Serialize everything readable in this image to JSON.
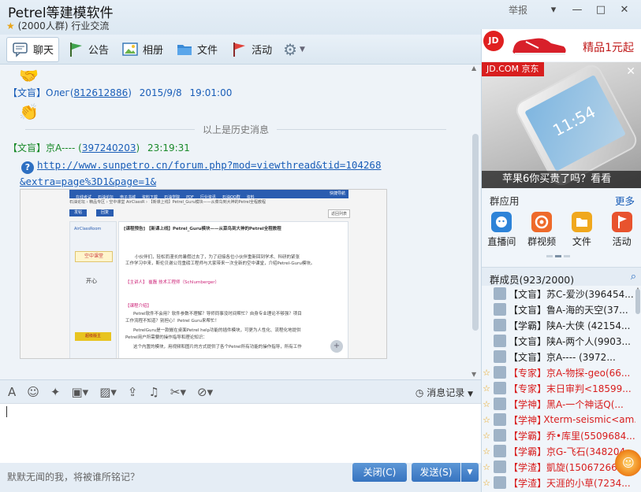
{
  "window": {
    "title": "Petrel等建模软件",
    "member_count": "(2000人群)",
    "category": "行业交流",
    "report_label": "举报",
    "controls": [
      "▾",
      "—",
      "□",
      "✕"
    ]
  },
  "toolbar": {
    "tabs": [
      {
        "label": "聊天",
        "icon": "chat-icon"
      },
      {
        "label": "公告",
        "icon": "announcement-flag-icon"
      },
      {
        "label": "相册",
        "icon": "album-icon"
      },
      {
        "label": "文件",
        "icon": "folder-icon"
      },
      {
        "label": "活动",
        "icon": "activity-flag-icon"
      }
    ],
    "settings_icon": "gear-icon"
  },
  "chat": {
    "msg1": {
      "role": "【文盲】",
      "sender": "Олег(",
      "qq": "812612886",
      "close": ")",
      "date": "2015/9/8",
      "time": "19:01:00"
    },
    "history_separator": "以上是历史消息",
    "msg2": {
      "role": "【文盲】",
      "sender": "京A----",
      "qq": "397240203",
      "time": "23:19:31",
      "link_line1": "http://www.sunpetro.cn/forum.php?mod=viewthread&tid=104268",
      "link_line2": "&extra=page%3D1&page=1&"
    }
  },
  "forum_shot": {
    "nav": [
      "在线考试",
      "石油论坛",
      "电子书城",
      "资料下载",
      "石油学院",
      "PDF",
      "行业资讯",
      "石油QQ群",
      "资料",
      "快捷导航"
    ],
    "breadcrumb": "石油论坛 › 精品专区 › 空中课堂 AirClassR › 【新课上线】Petrel_Guru模块——从菜鸟到大神的Petrel全程教程",
    "post_button": "发帖",
    "reply_button": "回复",
    "return_label": "返回列表",
    "board": "空中课堂",
    "post_title": "[课程预告] 【新课上线】Petrel_Guru模块——从菜鸟到大神的Petrel全程教程",
    "intro": "小伙伴们，轻松而漫长的暑假过去了，为了迎接各位小伙伴重新回到学术、科研的紧张",
    "intro2": "工作学习中来，斯伦贝谢公司重磅工程师与大家带来一次全新的空中课堂，介绍Petrel-Guru模块。",
    "speaker": "【主讲人】 崔磊  技术工程师（Schlumberger）",
    "course": "【课程介绍】",
    "line1": "Petrel软件不会用？软件参数不理解？导师同事没时间帮忙？自身专业理论不够强？项目",
    "line2": "工作流程不知道？别担心！Petrel Guru来帮忙！",
    "line3": "PetrelGuru是一款嵌在桌面Petrel help功能的插件模块，可更为人性化、流程化地提供",
    "line4": "Petrel用户所需要的操作指导和理论知识：",
    "line5": "这个内置的模块，用视频和图片的方式提供了各个Petrel所有功能的操作指导，所有工作",
    "rank_badge": "超级版主",
    "mood": "开心"
  },
  "input_bar": {
    "icons": [
      "font-icon",
      "emoji-icon",
      "magic-icon",
      "gift-icon",
      "image-icon",
      "upload-icon",
      "music-icon",
      "scissors-icon",
      "shake-icon"
    ],
    "history_label": "消息记录",
    "signature": "默默无闻的我，将被谁所铭记？",
    "close_button": "关闭(C)",
    "send_button": "发送(S)"
  },
  "ads": {
    "ad1_brand": "JD",
    "ad1_text": "精品1元起",
    "ad2_tag": "JD.COM 京东",
    "ad2_caption": "苹果6你买贵了吗？看看",
    "ad2_screen_time": "11:54"
  },
  "apps": {
    "header": "群应用",
    "more": "更多",
    "items": [
      {
        "label": "直播间",
        "icon": "live-room-icon",
        "color": "#2d83d8"
      },
      {
        "label": "群视频",
        "icon": "group-video-icon",
        "color": "#ee6a2a"
      },
      {
        "label": "文件",
        "icon": "file-icon",
        "color": "#f0a81e"
      },
      {
        "label": "活动",
        "icon": "activity-icon",
        "color": "#e8532e"
      }
    ]
  },
  "members": {
    "header": "群成员(923/2000)",
    "rows": [
      {
        "role": "【文盲】",
        "name": "苏C-爱沙(396454...",
        "color": "#222222"
      },
      {
        "role": "【文盲】",
        "name": "鲁A-海的天空(37...",
        "color": "#222222"
      },
      {
        "role": "【学霸】",
        "name": "陕A-大侠 (42154...",
        "color": "#222222"
      },
      {
        "role": "【文盲】",
        "name": "陕A-两个人(9903...",
        "color": "#222222"
      },
      {
        "role": "【文盲】",
        "name": "京A---- (3972...",
        "color": "#222222"
      },
      {
        "role": "【专家】",
        "name": "京A-物探-geo(66...",
        "color": "#d81e1e"
      },
      {
        "role": "【专家】",
        "name": "末日审判<18599...",
        "color": "#d81e1e"
      },
      {
        "role": "【学神】",
        "name": "黑A-一个神话Q(...",
        "color": "#d81e1e"
      },
      {
        "role": "【学神】",
        "name": "Xterm-seismic<am...",
        "color": "#d81e1e"
      },
      {
        "role": "【学霸】",
        "name": "乔•库里(5509684...",
        "color": "#d81e1e"
      },
      {
        "role": "【学霸】",
        "name": "京G-飞石(348204...",
        "color": "#d81e1e"
      },
      {
        "role": "【学渣】",
        "name": "凱旋(1506726605)",
        "color": "#d81e1e"
      },
      {
        "role": "【学渣】",
        "name": "天涯的小草(7234...",
        "color": "#d81e1e"
      }
    ]
  }
}
